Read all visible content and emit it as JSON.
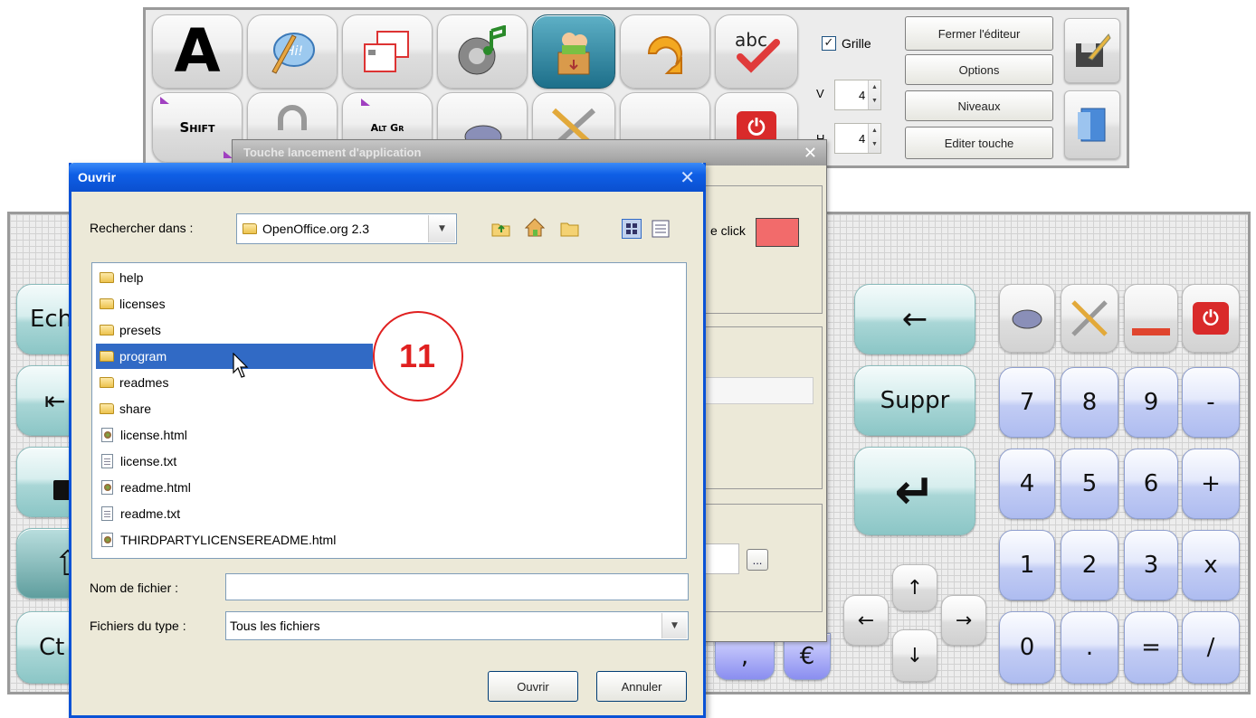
{
  "toolbar": {
    "grille_label": "Grille",
    "grille_checked": true,
    "v_label": "V",
    "h_label": "H",
    "v_value": "4",
    "h_value": "4",
    "close_editor_label": "Fermer l'éditeur",
    "options_label": "Options",
    "levels_label": "Niveaux",
    "edit_key_label": "Editer touche",
    "row1_icons": [
      "text-a-icon",
      "speech-hi-icon",
      "windows-icon",
      "music-speaker-icon",
      "user-box-icon",
      "arrow-return-icon",
      "spellcheck-abc-icon"
    ],
    "abc_text": "abc",
    "shift_label": "Shift",
    "altgr_label": "Alt Gr"
  },
  "behind_dialog": {
    "title": "Touche lancement d'application",
    "click_label": "e click",
    "click_color": "#f26b6b",
    "browse_label": "..."
  },
  "keyboard": {
    "left_keys": [
      "Ech",
      "",
      "",
      "",
      "Ct"
    ],
    "backspace": "←",
    "suppr": "Suppr",
    "enter": "↵",
    "numpad": [
      [
        "7",
        "8",
        "9",
        "-"
      ],
      [
        "4",
        "5",
        "6",
        "+"
      ],
      [
        "1",
        "2",
        "3",
        "x"
      ],
      [
        "0",
        ".",
        "=",
        "/"
      ]
    ],
    "arrows": {
      "up": "↑",
      "left": "←",
      "right": "→",
      "down": "↓"
    },
    "partial_keys": [
      ",",
      "€"
    ]
  },
  "open_dialog": {
    "title": "Ouvrir",
    "look_in_label": "Rechercher dans :",
    "look_in_value": "OpenOffice.org 2.3",
    "files": [
      {
        "name": "help",
        "type": "folder"
      },
      {
        "name": "licenses",
        "type": "folder"
      },
      {
        "name": "presets",
        "type": "folder"
      },
      {
        "name": "program",
        "type": "folder",
        "selected": true
      },
      {
        "name": "readmes",
        "type": "folder"
      },
      {
        "name": "share",
        "type": "folder"
      },
      {
        "name": "license.html",
        "type": "html"
      },
      {
        "name": "license.txt",
        "type": "txt"
      },
      {
        "name": "readme.html",
        "type": "html"
      },
      {
        "name": "readme.txt",
        "type": "txt"
      },
      {
        "name": "THIRDPARTYLICENSEREADME.html",
        "type": "html"
      }
    ],
    "filename_label": "Nom de fichier :",
    "filename_value": "",
    "filetype_label": "Fichiers du type :",
    "filetype_value": "Tous les fichiers",
    "open_button": "Ouvrir",
    "cancel_button": "Annuler"
  },
  "callout": {
    "number": "11",
    "color": "#e02020"
  }
}
